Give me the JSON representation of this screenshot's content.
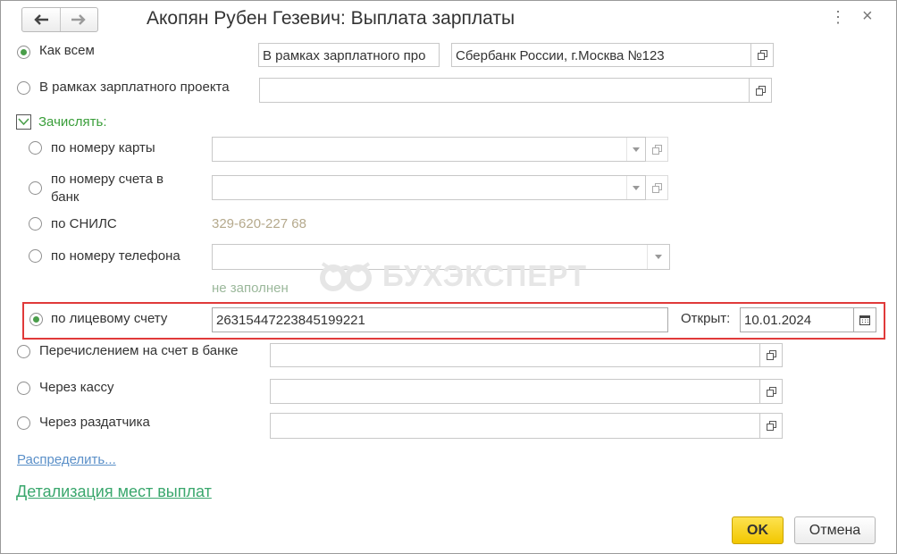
{
  "window": {
    "title": "Акопян Рубен Гезевич: Выплата зарплаты"
  },
  "toolbar": {
    "back_icon": "arrow-left",
    "forward_icon": "arrow-right",
    "menu_icon": "⋮",
    "close_icon": "×"
  },
  "options": {
    "as_all": {
      "label": "Как всем",
      "selected": true,
      "project_field": "В рамках зарплатного про",
      "bank_field": "Сбербанк России, г.Москва №123"
    },
    "salary_project": {
      "label": "В рамках зарплатного проекта",
      "value": ""
    }
  },
  "credit": {
    "label": "Зачислять:",
    "by_card": {
      "label": "по номеру карты",
      "value": ""
    },
    "by_bank_account": {
      "label_line1": "по номеру счета в",
      "label_line2": "банк",
      "value": ""
    },
    "by_snils": {
      "label": "по СНИЛС",
      "value": "329-620-227 68"
    },
    "by_phone": {
      "label": "по номеру телефона",
      "value": "",
      "hint": "не заполнен"
    },
    "by_personal_account": {
      "label": "по лицевому счету",
      "value": "26315447223845199221",
      "opened_label": "Открыт:",
      "opened_date": "10.01.2024",
      "selected": true
    }
  },
  "transfer_bank": {
    "label": "Перечислением на счет в банке",
    "value": ""
  },
  "cash_desk": {
    "label": "Через кассу",
    "value": ""
  },
  "distributor": {
    "label": "Через раздатчика",
    "value": ""
  },
  "links": {
    "distribute": "Распределить...",
    "details": "Детализация мест выплат"
  },
  "buttons": {
    "ok": "OK",
    "cancel": "Отмена"
  },
  "watermark": {
    "text": "БУХЭКСПЕРТ"
  },
  "colors": {
    "accent_green": "#4a9e4a",
    "highlight_red": "#e03a3a",
    "ok_yellow": "#f2c700"
  }
}
